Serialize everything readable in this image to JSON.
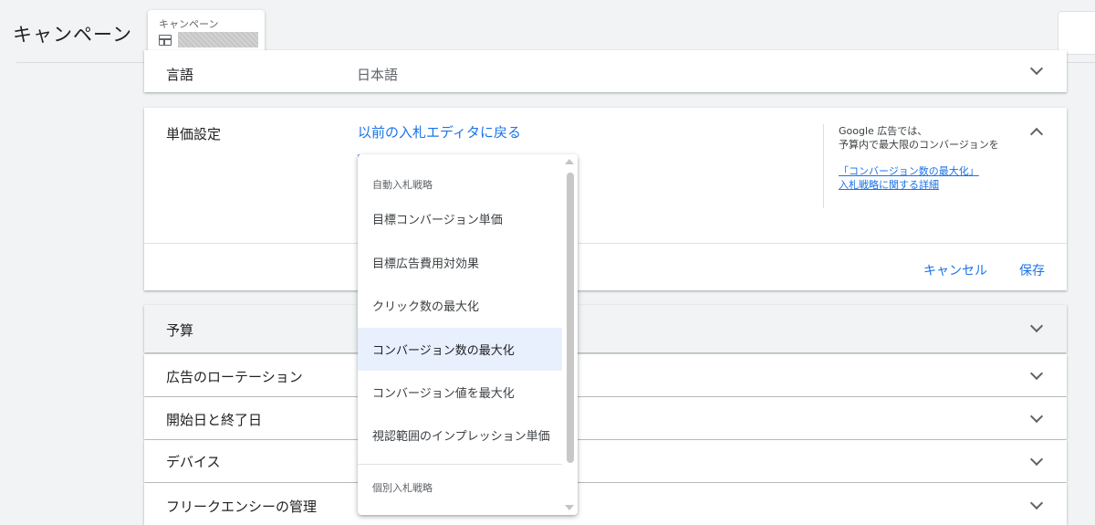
{
  "header": {
    "title": "キャンペーン",
    "crumb_label": "キャンペーン"
  },
  "sections": {
    "language": {
      "label": "言語",
      "value": "日本語"
    },
    "bidding": {
      "label": "単価設定",
      "link": "以前の入札エディタに戻る",
      "side_line1": "Google 広告では、",
      "side_line2": "予算内で最大限のコンバージョンを",
      "side_link1": "「コンバージョン数の最大化」",
      "side_link2": "入札戦略に関する詳細",
      "cancel": "キャンセル",
      "save": "保存"
    },
    "budget": {
      "label": "予算"
    },
    "ad_rotation": {
      "label": "広告のローテーション"
    },
    "dates": {
      "label": "開始日と終了日"
    },
    "devices": {
      "label": "デバイス"
    },
    "frequency": {
      "label": "フリークエンシーの管理"
    }
  },
  "dropdown": {
    "auto_header": "自動入札戦略",
    "items": [
      "目標コンバージョン単価",
      "目標広告費用対効果",
      "クリック数の最大化",
      "コンバージョン数の最大化",
      "コンバージョン値を最大化",
      "視認範囲のインプレッション単価"
    ],
    "selected_index": 3,
    "manual_header": "個別入札戦略"
  },
  "colors": {
    "accent": "#1a73e8",
    "selected_bg": "#e8f0fe",
    "page_bg": "#f1f3f4"
  }
}
